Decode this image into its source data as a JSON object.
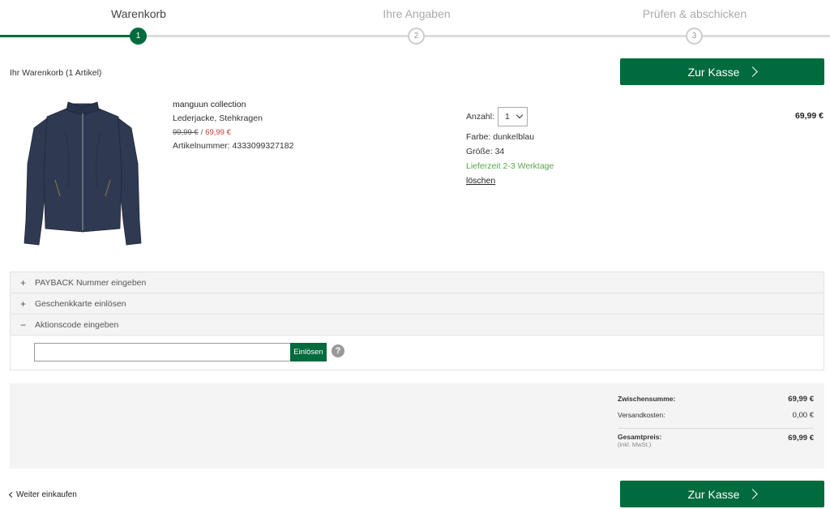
{
  "steps": [
    {
      "label": "Warenkorb",
      "number": "1",
      "active": true
    },
    {
      "label": "Ihre Angaben",
      "number": "2",
      "active": false
    },
    {
      "label": "Prüfen & abschicken",
      "number": "3",
      "active": false
    }
  ],
  "checkout_label": "Zur Kasse",
  "cart_title": "Ihr Warenkorb (1 Artikel)",
  "product": {
    "brand": "manguun collection",
    "name": "Lederjacke, Stehkragen",
    "old_price": "99,99 €",
    "price_separator": "/",
    "new_price": "69,99 €",
    "article_number": "Artikelnummer: 4333099327182",
    "qty_label": "Anzahl:",
    "qty_value": "1",
    "color": "Farbe: dunkelblau",
    "size": "Größe: 34",
    "delivery": "Lieferzeit 2-3 Werktage",
    "delete_label": "löschen",
    "line_total": "69,99 €"
  },
  "accordion": {
    "payback": {
      "sign": "+",
      "label": "PAYBACK Nummer eingeben"
    },
    "giftcard": {
      "sign": "+",
      "label": "Geschenkkarte einlösen"
    },
    "promo": {
      "sign": "−",
      "label": "Aktionscode eingeben"
    },
    "promo_value": "",
    "redeem_label": "Einlösen",
    "help_glyph": "?"
  },
  "summary": {
    "subtotal_label": "Zwischensumme:",
    "subtotal_value": "69,99 €",
    "shipping_label": "Versandkosten:",
    "shipping_value": "0,00 €",
    "total_label": "Gesamtpreis:",
    "total_note": "(inkl. MwSt.)",
    "total_value": "69,99 €"
  },
  "back_label": "Weiter einkaufen",
  "colors": {
    "brand_green": "#006b3c",
    "price_red": "#c0392b",
    "delivery_green": "#5aa54a"
  }
}
